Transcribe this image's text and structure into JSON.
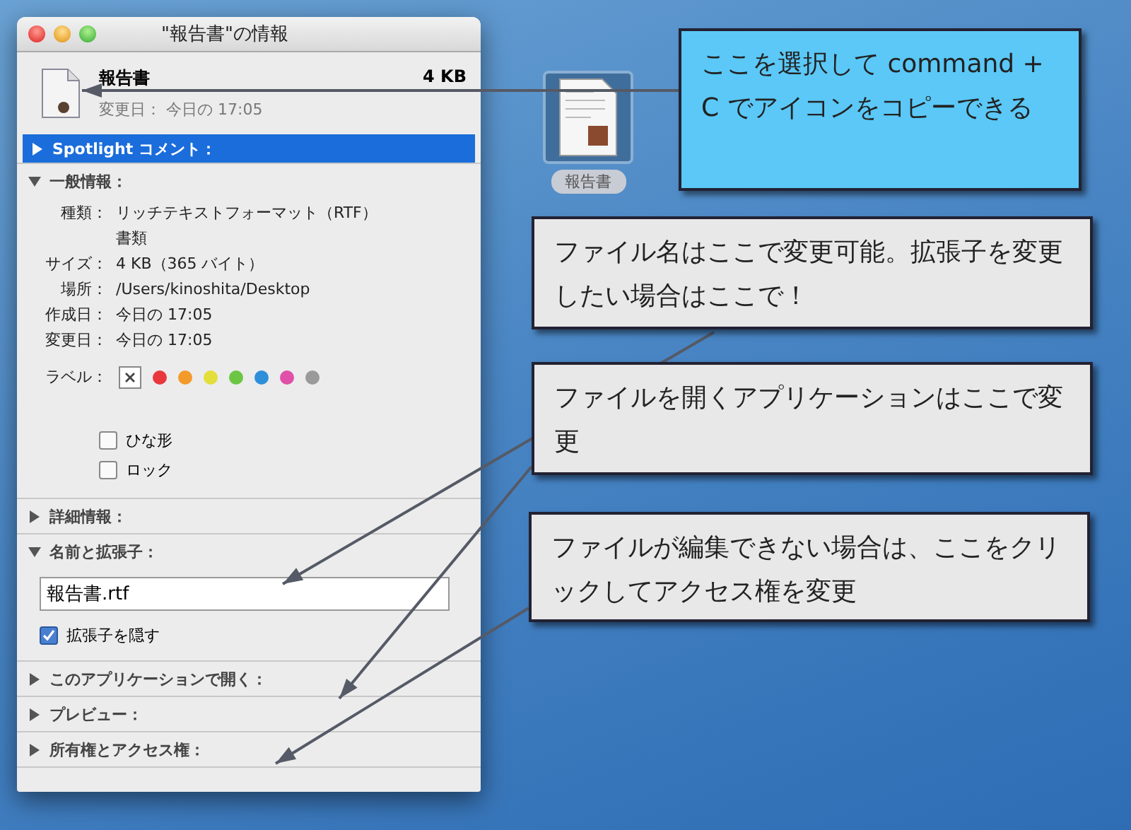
{
  "window": {
    "title": "\"報告書\"の情報"
  },
  "file": {
    "name": "報告書",
    "size": "4 KB",
    "modified": "変更日： 今日の 17:05"
  },
  "sections": [
    {
      "label": "Spotlight コメント：",
      "expanded": false,
      "selected": true
    },
    {
      "label": "一般情報：",
      "expanded": true,
      "selected": false,
      "rows": [
        {
          "label": "種類：",
          "value": "リッチテキストフォーマット（RTF）書類"
        },
        {
          "label": "サイズ：",
          "value": "4 KB（365 バイト）"
        },
        {
          "label": "場所：",
          "value": "/Users/kinoshita/Desktop"
        },
        {
          "label": "作成日：",
          "value": "今日の 17:05"
        },
        {
          "label": "変更日：",
          "value": "今日の 17:05"
        }
      ],
      "label_title": "ラベル：",
      "label_colors": [
        {
          "color": "#e8383d"
        },
        {
          "color": "#f39a2a"
        },
        {
          "color": "#e3de3a"
        },
        {
          "color": "#6cc644"
        },
        {
          "color": "#2e8fd9"
        },
        {
          "color": "#e04fa8"
        },
        {
          "color": "#9a9a9a"
        }
      ],
      "checkboxes": [
        {
          "label": "ひな形",
          "checked": false
        },
        {
          "label": "ロック",
          "checked": false
        }
      ]
    },
    {
      "label": "詳細情報：",
      "expanded": false,
      "selected": false
    },
    {
      "label": "名前と拡張子：",
      "expanded": true,
      "selected": false,
      "value": "報告書.rtf",
      "checkboxes": [
        {
          "label": "拡張子を隠す",
          "checked": true
        }
      ]
    },
    {
      "label": "このアプリケーションで開く：",
      "expanded": false,
      "selected": false
    },
    {
      "label": "プレビュー：",
      "expanded": false,
      "selected": false
    },
    {
      "label": "所有権とアクセス権：",
      "expanded": false,
      "selected": false
    }
  ],
  "desktop_icon": {
    "label": "報告書"
  },
  "callouts": [
    {
      "kind": "highlight",
      "text": "ここを選択して command + C でアイコンをコピーできる"
    },
    {
      "kind": "note",
      "text": "ファイル名はここで変更可能。拡張子を変更したい場合はここで！"
    },
    {
      "kind": "note",
      "text": "ファイルを開くアプリケーションはここで変更"
    },
    {
      "kind": "note",
      "text": "ファイルが編集できない場合は、ここをクリックしてアクセス権を変更"
    }
  ]
}
